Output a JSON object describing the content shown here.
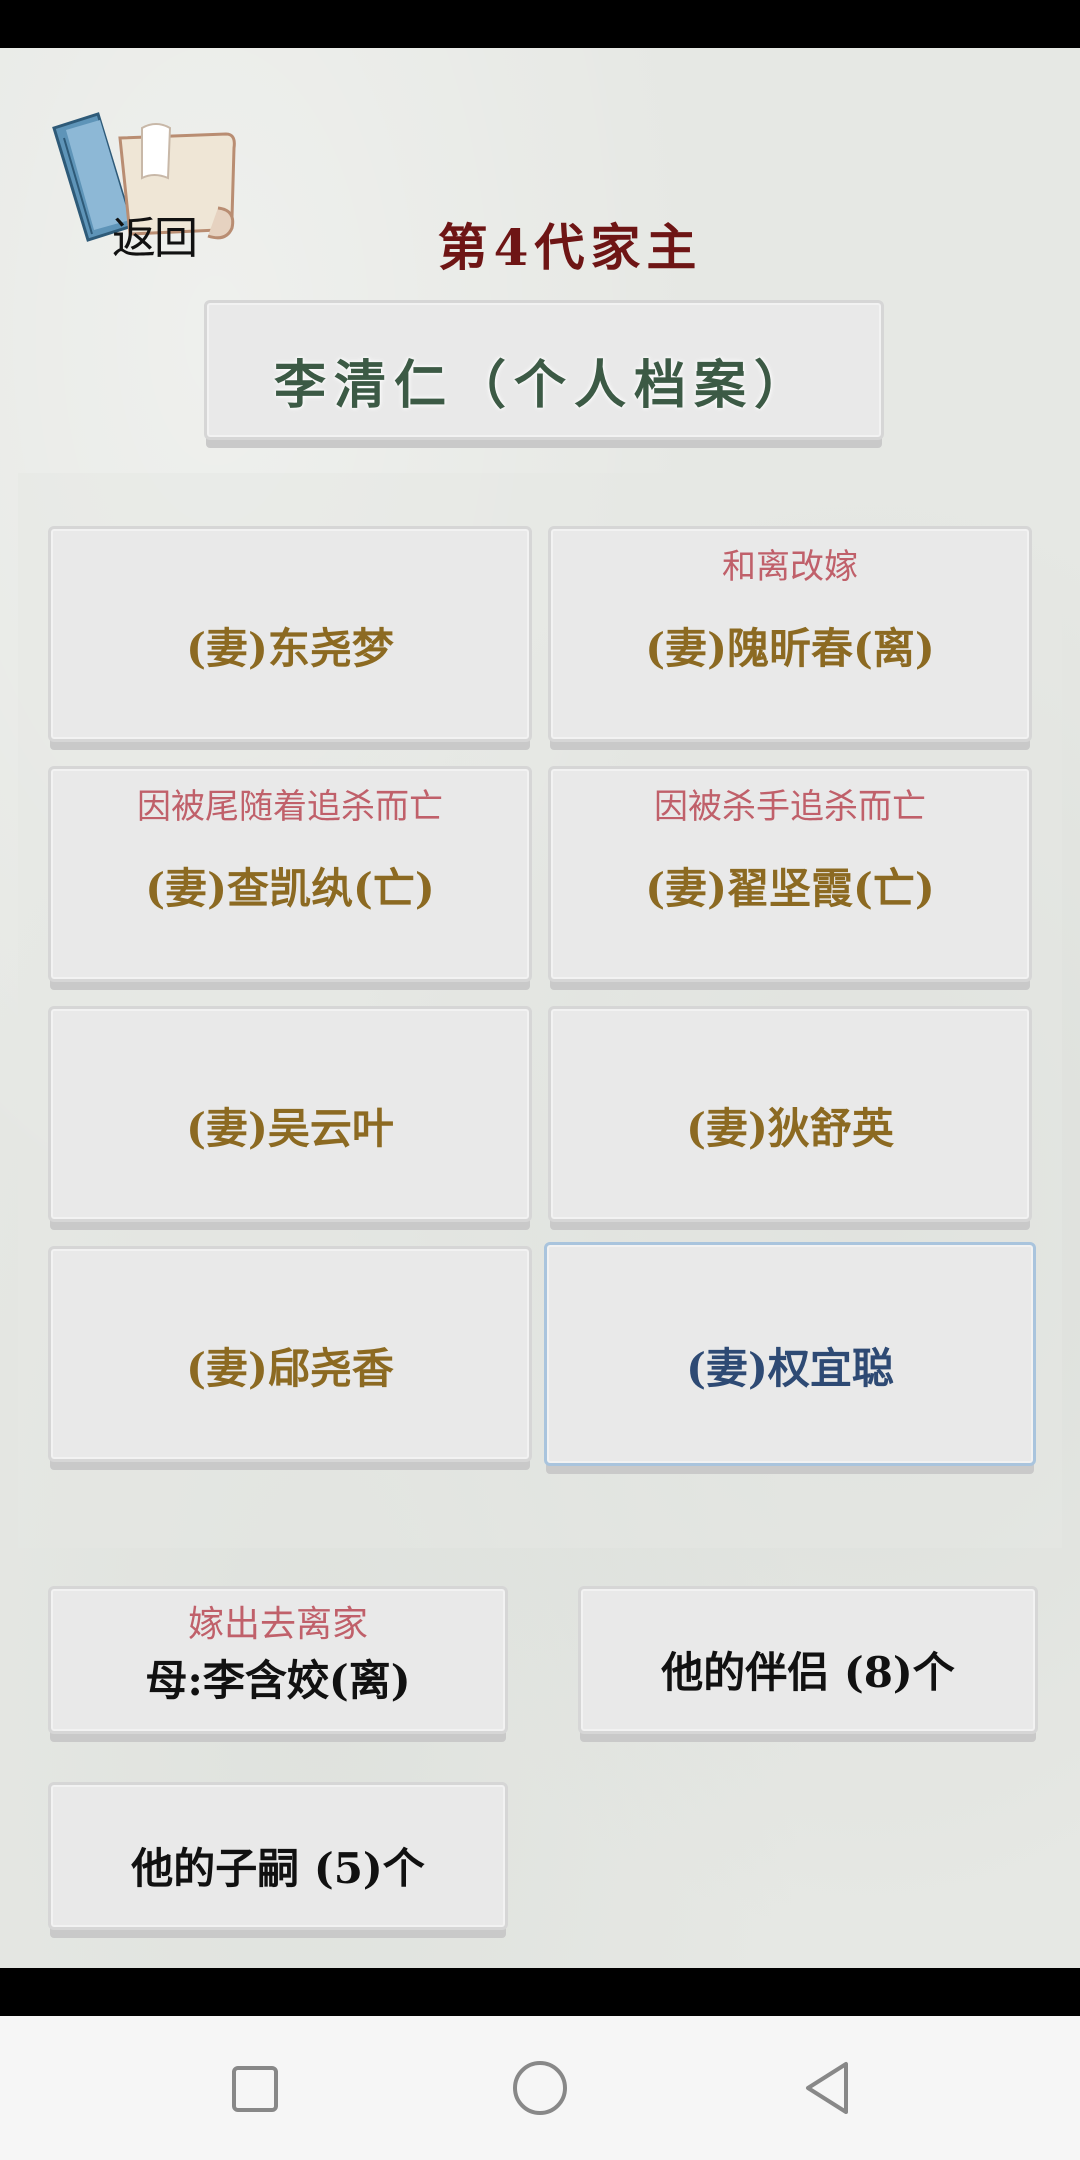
{
  "header": {
    "back_label": "返回",
    "generation_title": "第4代家主",
    "profile_title": "李清仁（个人档案）"
  },
  "spouses": [
    {
      "note": "",
      "name": "(妻)东尧梦"
    },
    {
      "note": "和离改嫁",
      "name": "(妻)隗昕春(离)"
    },
    {
      "note": "因被尾随着追杀而亡",
      "name": "(妻)查凯纨(亡)"
    },
    {
      "note": "因被杀手追杀而亡",
      "name": "(妻)翟坚霞(亡)"
    },
    {
      "note": "",
      "name": "(妻)吴云叶"
    },
    {
      "note": "",
      "name": "(妻)狄舒英"
    },
    {
      "note": "",
      "name": "(妻)郈尧香"
    },
    {
      "note": "",
      "name": "(妻)权宜聪"
    }
  ],
  "bottom": {
    "mother_note": "嫁出去离家",
    "mother_name": "母:李含姣(离)",
    "partners": "他的伴侣 (8)个",
    "children": "他的子嗣 (5)个"
  },
  "icons": {
    "back": "scroll-book-icon",
    "nav_recent": "square-icon",
    "nav_home": "circle-icon",
    "nav_back": "triangle-back-icon"
  },
  "colors": {
    "generation_title": "#6e1515",
    "profile_title": "#3c5a45",
    "spouse_name": "#8c6a22",
    "selected_name": "#2e4a74",
    "note": "#c0606a"
  }
}
